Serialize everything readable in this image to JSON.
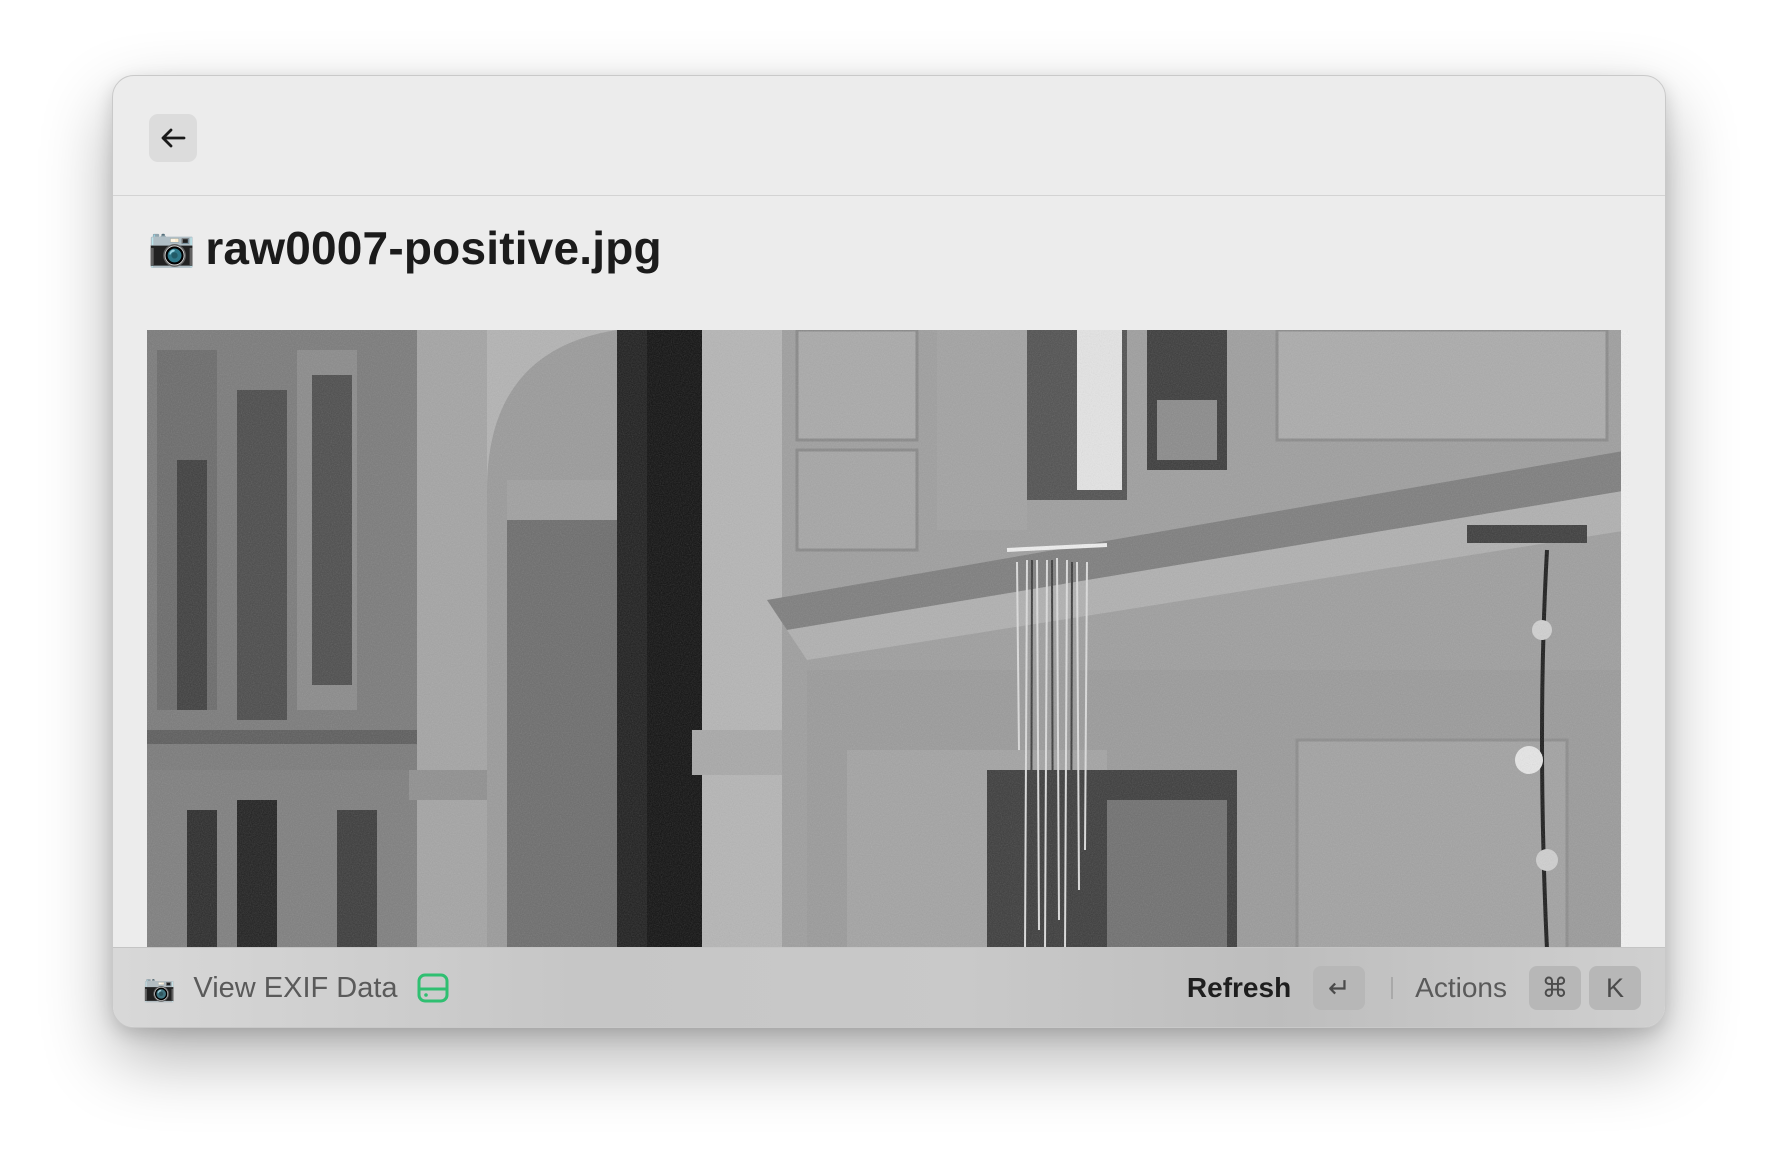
{
  "header": {
    "back_icon": "arrow-left-icon"
  },
  "file": {
    "emoji": "📷",
    "name": "raw0007-positive.jpg"
  },
  "footer": {
    "left_emoji": "📷",
    "action_label": "View EXIF Data",
    "action_icon": "hard-drive-icon",
    "action_icon_color": "#2fbf71",
    "primary_label": "Refresh",
    "primary_shortcut": "↵",
    "actions_label": "Actions",
    "actions_shortcut_mod": "⌘",
    "actions_shortcut_key": "K"
  }
}
